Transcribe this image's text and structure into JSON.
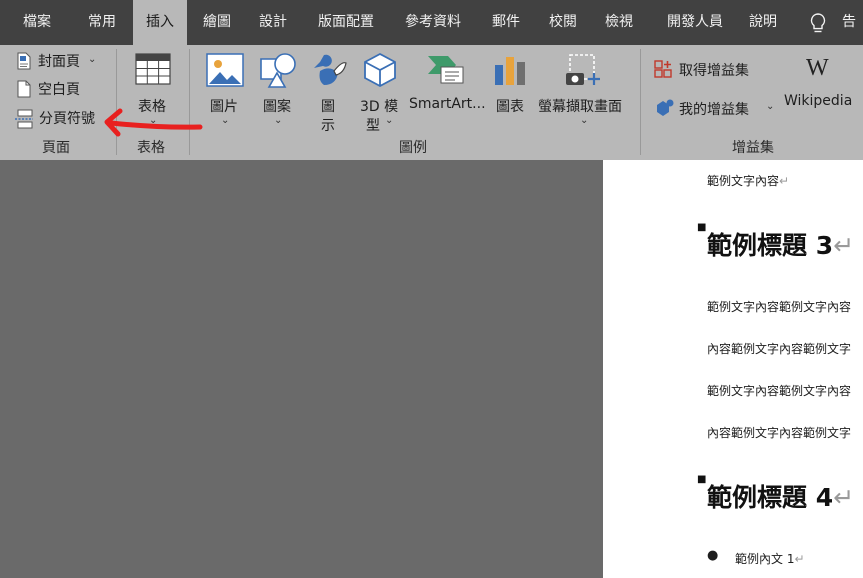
{
  "menu": {
    "tabs": [
      "檔案",
      "常用",
      "插入",
      "繪圖",
      "設計",
      "版面配置",
      "參考資料",
      "郵件",
      "校閱",
      "檢視",
      "開發人員",
      "說明"
    ],
    "active_index": 2,
    "tell_me": "告"
  },
  "ribbon": {
    "pages_group": {
      "cover_page": "封面頁",
      "blank_page": "空白頁",
      "page_break": "分頁符號",
      "label": "頁面"
    },
    "tables_group": {
      "table": "表格",
      "label": "表格"
    },
    "illustrations_group": {
      "pictures": "圖片",
      "shapes": "圖案",
      "icons_line1": "圖",
      "icons_line2": "示",
      "models_line1": "3D 模",
      "models_line2": "型",
      "smartart": "SmartArt...",
      "chart": "圖表",
      "screenshot": "螢幕擷取畫面",
      "label": "圖例"
    },
    "addins_group": {
      "get_addins": "取得增益集",
      "my_addins": "我的增益集",
      "wikipedia": "Wikipedia",
      "wiki_logo": "W",
      "label": "增益集"
    },
    "colors": {
      "ribbon_bg": "#b8b8b8",
      "menubar_bg": "#414141",
      "annotation_arrow": "#e8201f"
    }
  },
  "document": {
    "line1": "範例文字內容",
    "heading3": "範例標題 3",
    "para1": "範例文字內容範例文字內容",
    "para2": "內容範例文字內容範例文字",
    "para3": "範例文字內容範例文字內容",
    "para4": "內容範例文字內容範例文字",
    "heading4": "範例標題 4",
    "bullet1": "範例內文 1"
  }
}
